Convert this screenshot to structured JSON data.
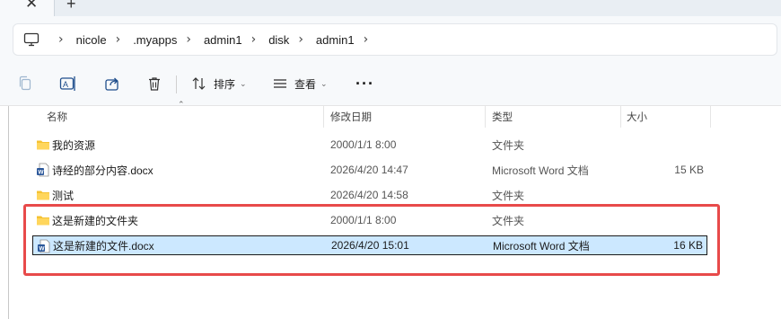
{
  "tabs": {
    "close_glyph": "✕",
    "add_glyph": "+"
  },
  "address": {
    "root_icon": "computer-icon",
    "crumbs": [
      "nicole",
      ".myapps",
      "admin1",
      "disk",
      "admin1"
    ],
    "separator": "›"
  },
  "toolbar": {
    "copy_icon": "copy-icon",
    "rename_icon": "rename-icon",
    "share_icon": "share-icon",
    "delete_icon": "trash-icon",
    "sort_label": "排序",
    "view_label": "查看",
    "more_label": "···"
  },
  "columns": {
    "name": "名称",
    "modified": "修改日期",
    "type": "类型",
    "size": "大小"
  },
  "files": [
    {
      "icon": "folder-icon",
      "name": "我的资源",
      "modified": "2000/1/1 8:00",
      "type": "文件夹",
      "size": ""
    },
    {
      "icon": "word-doc-icon",
      "name": "诗经的部分内容.docx",
      "modified": "2026/4/20 14:47",
      "type": "Microsoft Word 文档",
      "size": "15 KB"
    },
    {
      "icon": "folder-icon",
      "name": "测试",
      "modified": "2026/4/20 14:58",
      "type": "文件夹",
      "size": ""
    },
    {
      "icon": "folder-icon",
      "name": "这是新建的文件夹",
      "modified": "2000/1/1 8:00",
      "type": "文件夹",
      "size": ""
    },
    {
      "icon": "word-doc-icon",
      "name": "这是新建的文件.docx",
      "modified": "2026/4/20 15:01",
      "type": "Microsoft Word 文档",
      "size": "16 KB",
      "selected": true
    }
  ],
  "colors": {
    "folder": "#f5c232",
    "selection": "#cce8ff",
    "highlight": "#e84a4a",
    "word_blue": "#2b579a"
  }
}
